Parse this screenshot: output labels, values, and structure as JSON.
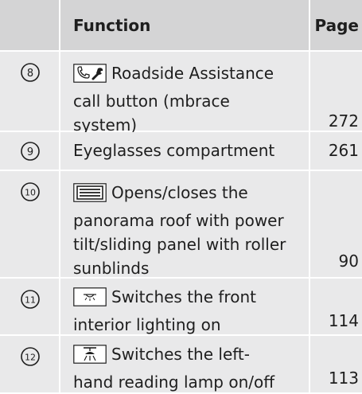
{
  "header": {
    "function_label": "Function",
    "page_label": "Page"
  },
  "rows": [
    {
      "number": "8",
      "icon": "phone-wrench-icon",
      "lines": [
        "Roadside Assistance",
        "call button (mbrace",
        "system)"
      ],
      "page": "272"
    },
    {
      "number": "9",
      "icon": "",
      "lines": [
        "Eyeglasses compartment"
      ],
      "page": "261"
    },
    {
      "number": "10",
      "icon": "panorama-roof-icon",
      "lines": [
        "Opens/closes the",
        "panorama roof with power",
        "tilt/sliding panel with roller",
        "sunblinds"
      ],
      "page": "90"
    },
    {
      "number": "11",
      "icon": "interior-light-icon",
      "lines": [
        "Switches the front",
        "interior lighting on"
      ],
      "page": "114"
    },
    {
      "number": "12",
      "icon": "reading-lamp-icon",
      "lines": [
        "Switches the left-",
        "hand reading lamp on/off"
      ],
      "page": "113"
    }
  ]
}
